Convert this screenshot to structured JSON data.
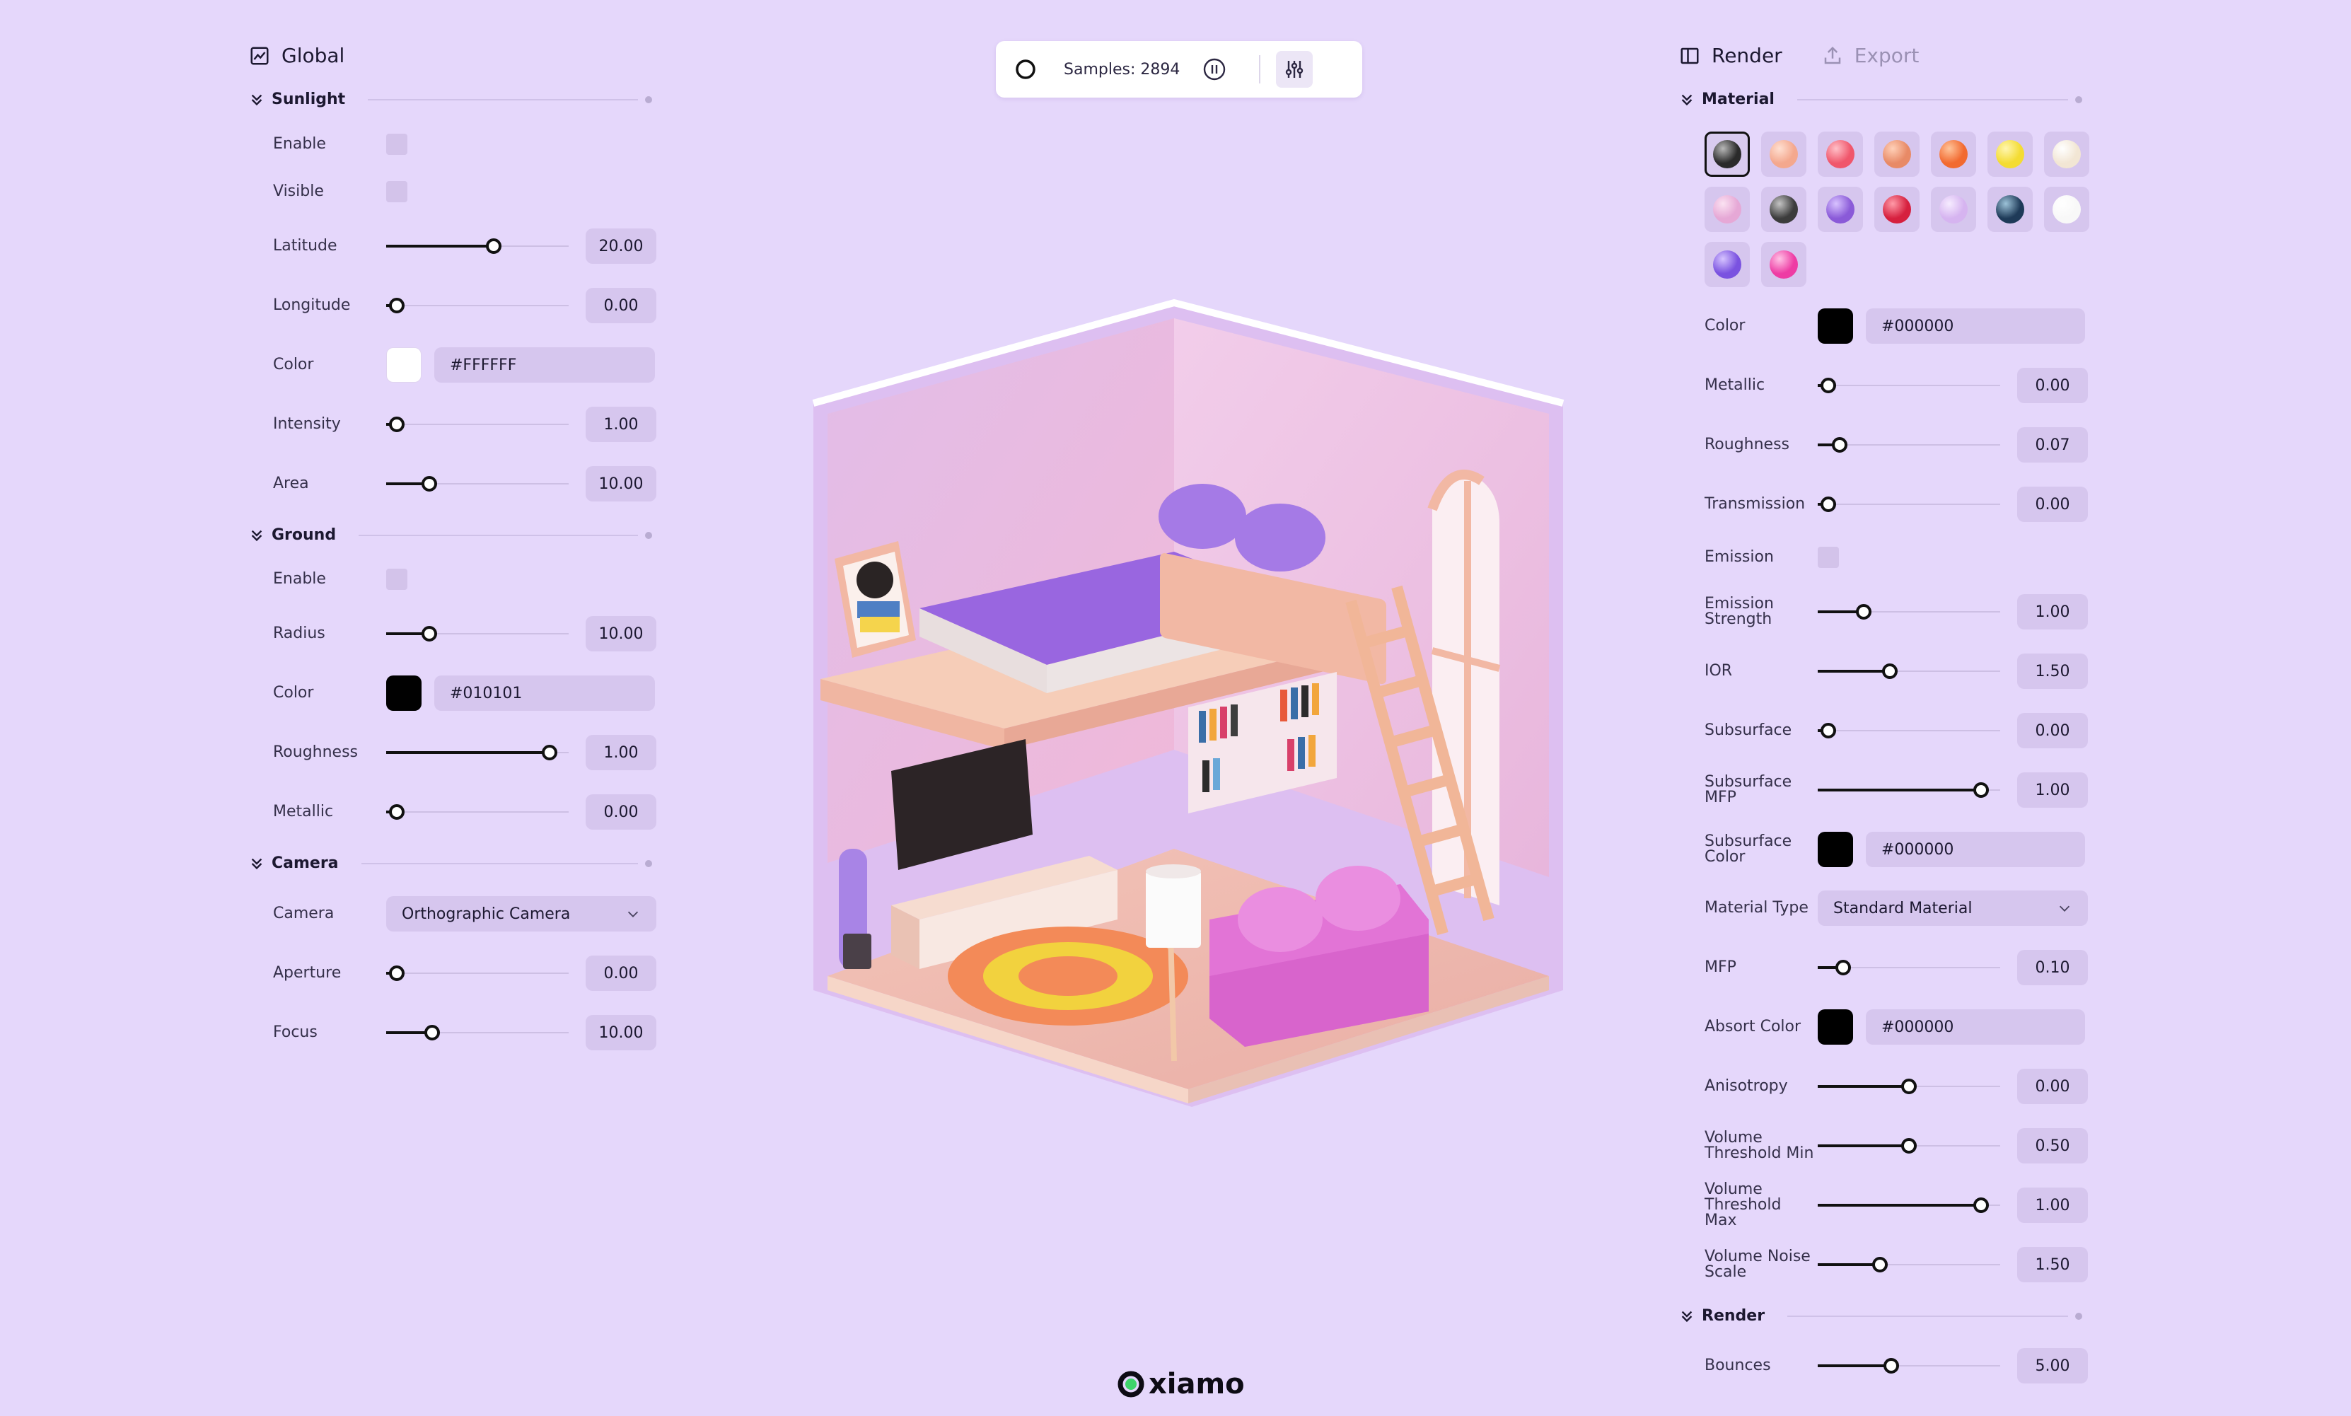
{
  "left": {
    "title": "Global",
    "sections": {
      "sunlight": {
        "title": "Sunlight",
        "enable_label": "Enable",
        "visible_label": "Visible",
        "latitude": {
          "label": "Latitude",
          "value": "20.00",
          "fraction": 0.6
        },
        "longitude": {
          "label": "Longitude",
          "value": "0.00",
          "fraction": 0.0
        },
        "color": {
          "label": "Color",
          "hex": "#FFFFFF",
          "swatch": "#ffffff"
        },
        "intensity": {
          "label": "Intensity",
          "value": "1.00",
          "fraction": 0.0
        },
        "area": {
          "label": "Area",
          "value": "10.00",
          "fraction": 0.2
        }
      },
      "ground": {
        "title": "Ground",
        "enable_label": "Enable",
        "radius": {
          "label": "Radius",
          "value": "10.00",
          "fraction": 0.2
        },
        "color": {
          "label": "Color",
          "hex": "#010101",
          "swatch": "#010101"
        },
        "roughness": {
          "label": "Roughness",
          "value": "1.00",
          "fraction": 0.95
        },
        "metallic": {
          "label": "Metallic",
          "value": "0.00",
          "fraction": 0.0
        }
      },
      "camera": {
        "title": "Camera",
        "camera": {
          "label": "Camera",
          "value": "Orthographic Camera"
        },
        "aperture": {
          "label": "Aperture",
          "value": "0.00",
          "fraction": 0.0
        },
        "focus": {
          "label": "Focus",
          "value": "10.00",
          "fraction": 0.22
        }
      }
    }
  },
  "toolbar": {
    "samples": "Samples: 2894"
  },
  "right": {
    "tabs": {
      "render": "Render",
      "export": "Export"
    },
    "material": {
      "title": "Material",
      "presets": [
        {
          "color": "#2a2a2a",
          "hi": "#b8b8b8"
        },
        {
          "color": "#f4a88e",
          "hi": "#ffe0d2"
        },
        {
          "color": "#f0566b",
          "hi": "#ffc0c8"
        },
        {
          "color": "#e88a66",
          "hi": "#ffd0b8"
        },
        {
          "color": "#f26a30",
          "hi": "#ffc49a"
        },
        {
          "color": "#f4dc32",
          "hi": "#fff6b0"
        },
        {
          "color": "#f2e6d4",
          "hi": "#ffffff"
        },
        {
          "color": "#e6a8d6",
          "hi": "#fbe2f2"
        },
        {
          "color": "#3c3c3c",
          "hi": "#c4c4c4"
        },
        {
          "color": "#8a5ad8",
          "hi": "#d8c2ff"
        },
        {
          "color": "#d6203e",
          "hi": "#ff9aa8"
        },
        {
          "color": "#d6b4f0",
          "hi": "#f6ecff"
        },
        {
          "color": "#1e3a58",
          "hi": "#9cc2d8"
        },
        {
          "color": "#f8f8f8",
          "hi": "#ffffff"
        },
        {
          "color": "#7a52e0",
          "hi": "#d6c4ff"
        },
        {
          "color": "#ee3ca4",
          "hi": "#ffc2e6"
        }
      ],
      "color": {
        "label": "Color",
        "hex": "#000000",
        "swatch": "#000000"
      },
      "metallic": {
        "label": "Metallic",
        "value": "0.00",
        "fraction": 0.0
      },
      "roughness": {
        "label": "Roughness",
        "value": "0.07",
        "fraction": 0.07
      },
      "transmission": {
        "label": "Transmission",
        "value": "0.00",
        "fraction": 0.0
      },
      "emission_label": "Emission",
      "emission_strength": {
        "label": "Emission Strength",
        "value": "1.00",
        "fraction": 0.22
      },
      "ior": {
        "label": "IOR",
        "value": "1.50",
        "fraction": 0.38
      },
      "subsurface": {
        "label": "Subsurface",
        "value": "0.00",
        "fraction": 0.0
      },
      "subsurface_mfp": {
        "label": "Subsurface MFP",
        "value": "1.00",
        "fraction": 0.95
      },
      "subsurface_color": {
        "label": "Subsurface Color",
        "hex": "#000000",
        "swatch": "#000000"
      },
      "material_type": {
        "label": "Material Type",
        "value": "Standard Material"
      },
      "mfp": {
        "label": "MFP",
        "value": "0.10",
        "fraction": 0.09
      },
      "absorb_color": {
        "label": "Absort Color",
        "hex": "#000000",
        "swatch": "#000000"
      },
      "anisotropy": {
        "label": "Anisotropy",
        "value": "0.00",
        "fraction": 0.5
      },
      "vol_min": {
        "label": "Volume Threshold Min",
        "value": "0.50",
        "fraction": 0.5
      },
      "vol_max": {
        "label": "Volume Threshold Max",
        "value": "1.00",
        "fraction": 0.95
      },
      "vol_noise": {
        "label": "Volume Noise Scale",
        "value": "1.50",
        "fraction": 0.32
      }
    },
    "render": {
      "title": "Render",
      "bounces": {
        "label": "Bounces",
        "value": "5.00",
        "fraction": 0.39
      }
    }
  },
  "logo": "xiamo"
}
